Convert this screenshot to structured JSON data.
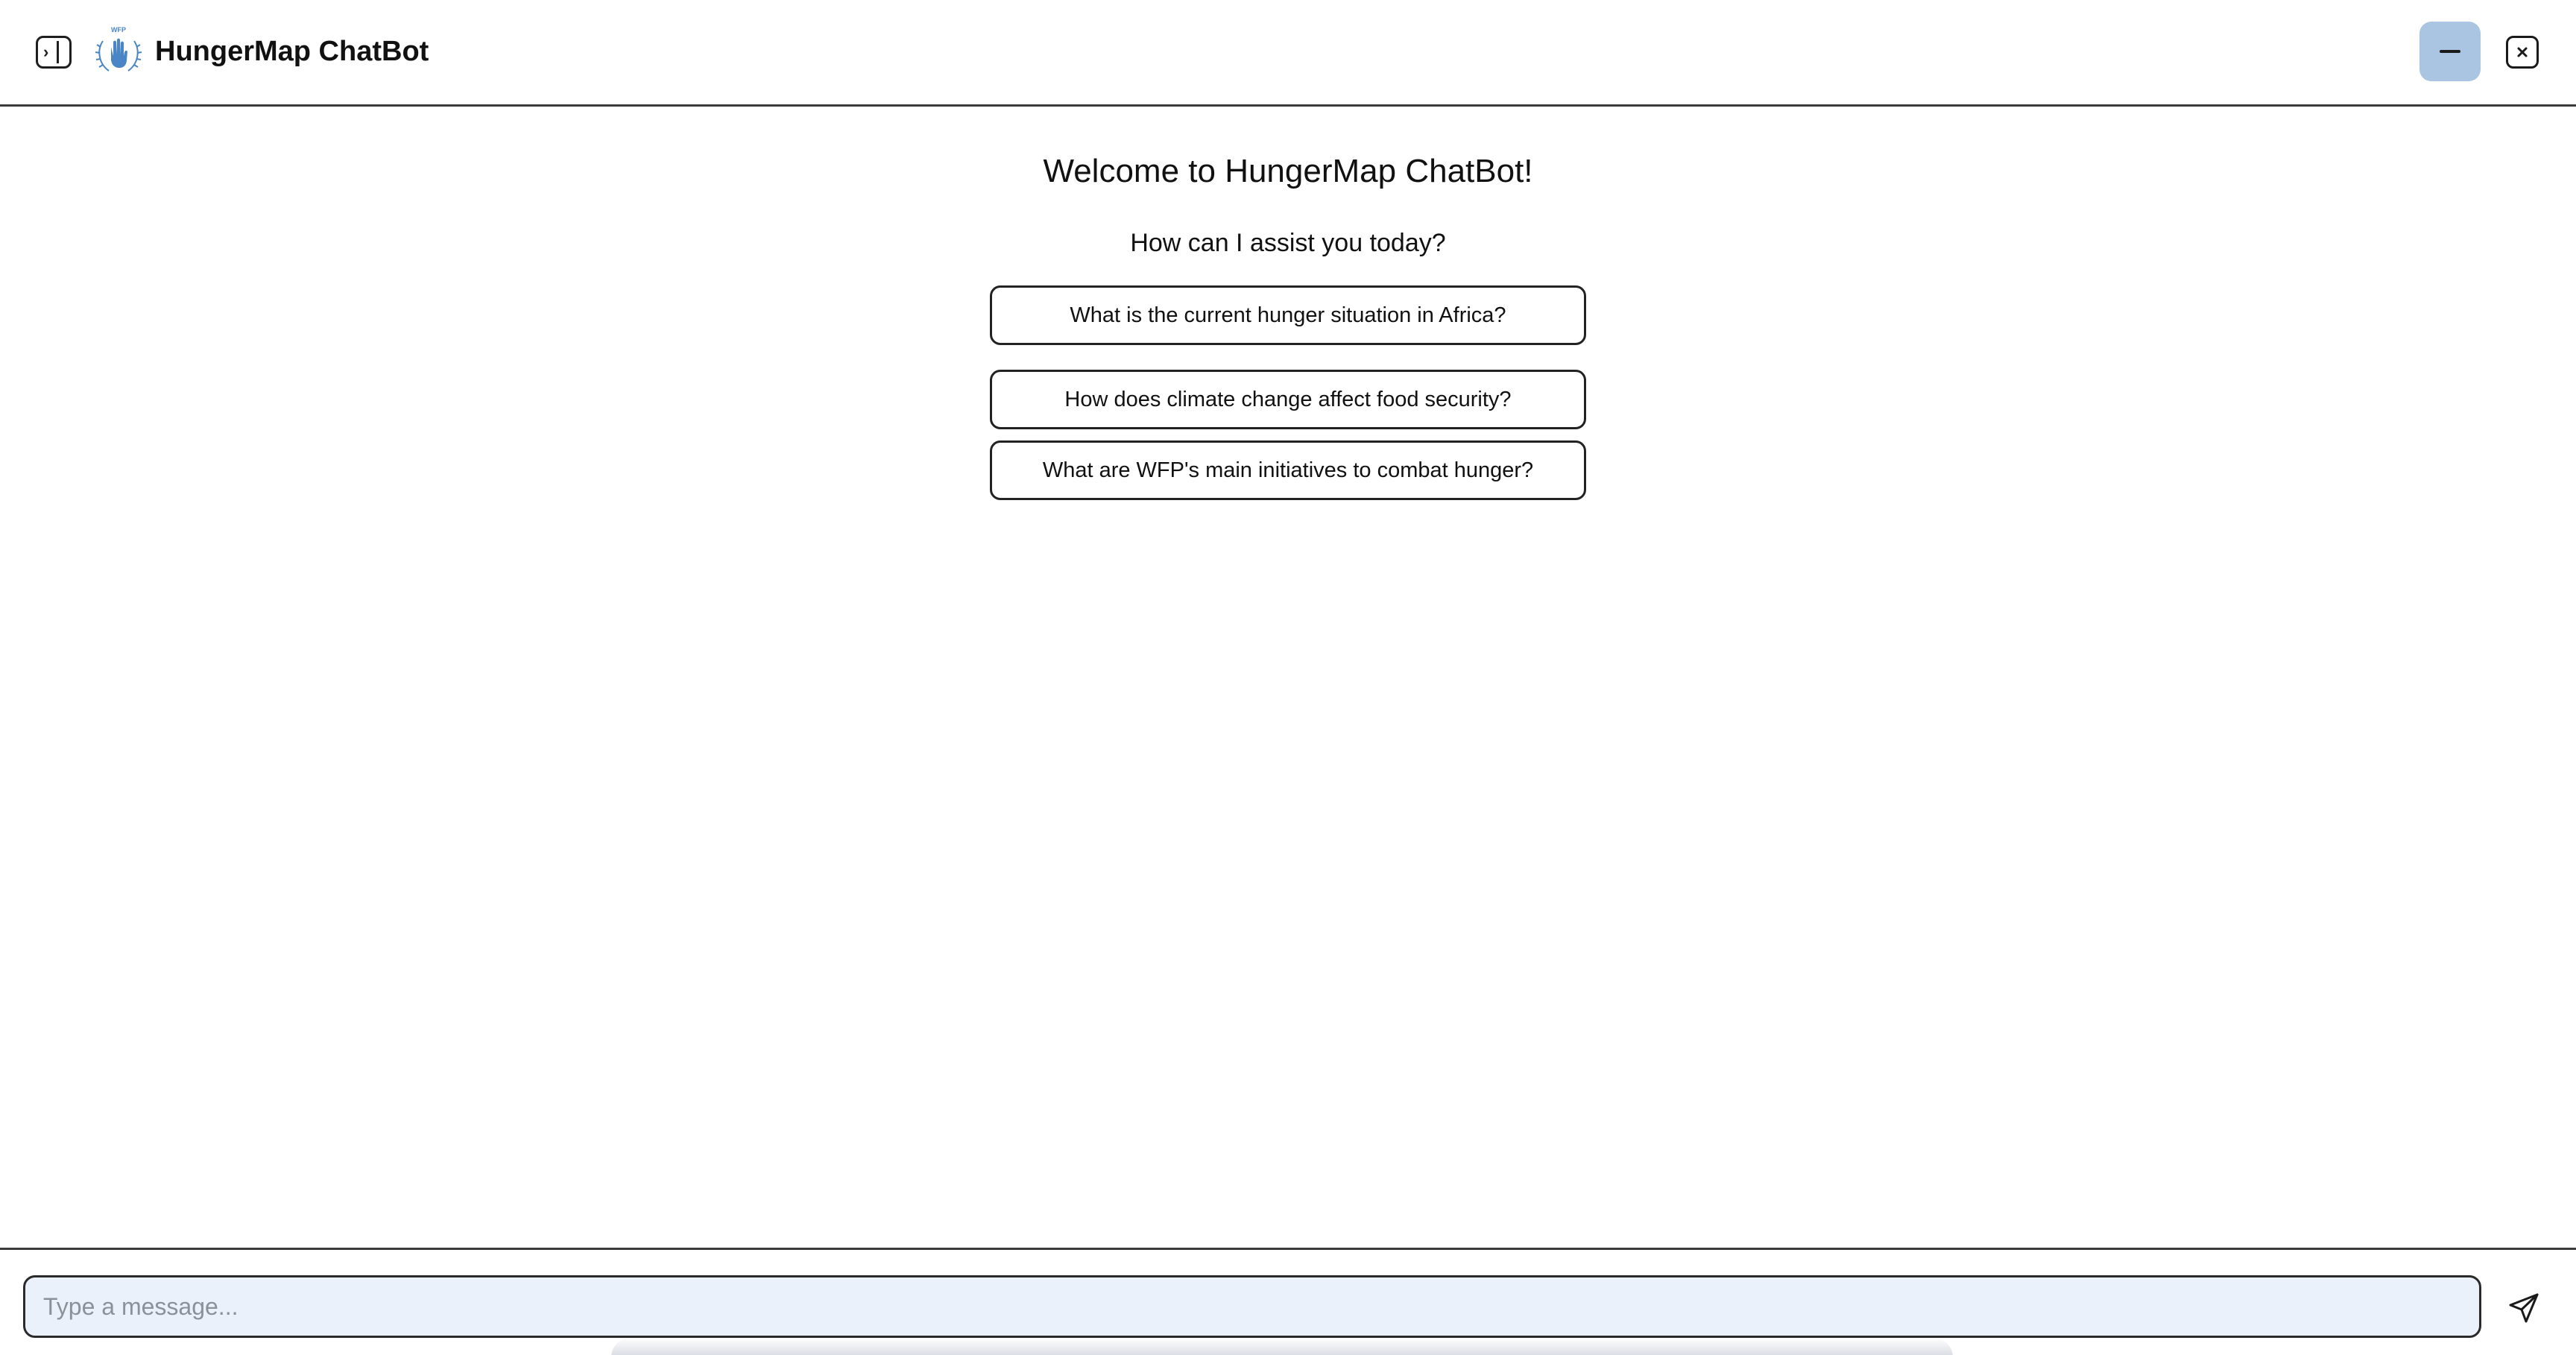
{
  "header": {
    "title": "HungerMap ChatBot",
    "logo_icon": "wfp-logo-icon",
    "sidebar_toggle_icon": "sidebar-toggle-icon",
    "minimize_icon": "minimize-icon",
    "close_icon": "close-icon",
    "accent_color": "#a9c5e2"
  },
  "main": {
    "welcome": "Welcome to HungerMap ChatBot!",
    "subtitle": "How can I assist you today?",
    "suggestions": [
      "What is the current hunger situation in Africa?",
      "How does climate change affect food security?",
      "What are WFP's main initiatives to combat hunger?"
    ]
  },
  "footer": {
    "input_placeholder": "Type a message...",
    "input_value": "",
    "send_icon": "send-icon",
    "input_background": "#eaf1fb"
  }
}
